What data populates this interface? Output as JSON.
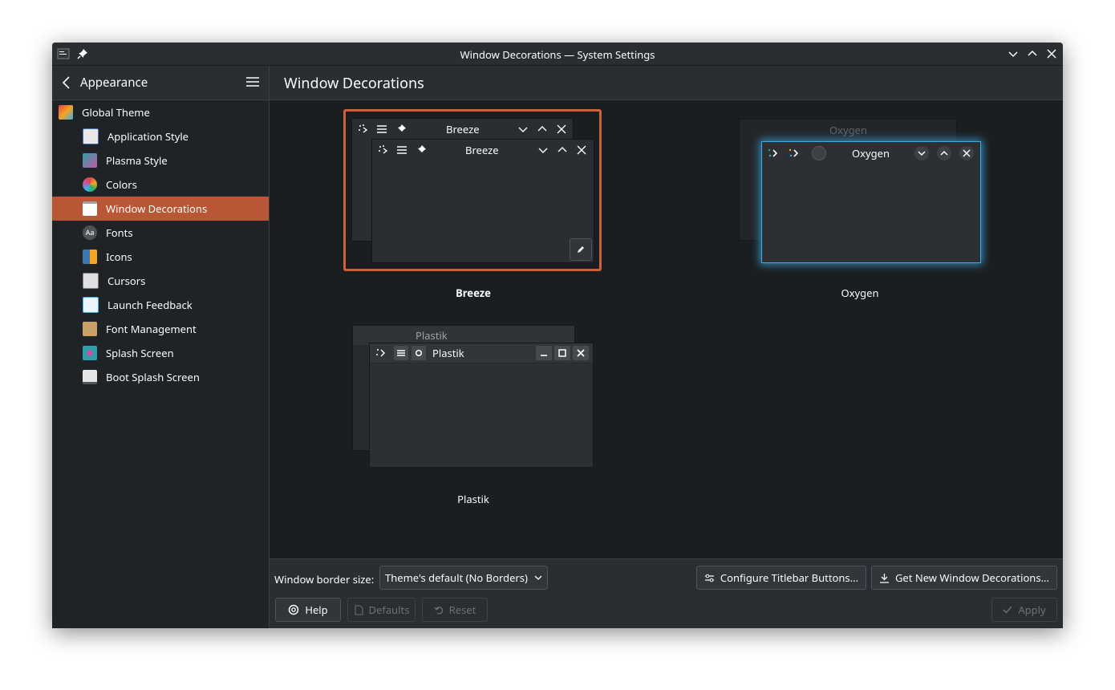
{
  "window": {
    "title": "Window Decorations — System Settings"
  },
  "sidebar": {
    "header": "Appearance",
    "items": [
      {
        "label": "Global Theme",
        "icon": "global-theme-icon",
        "color": "#e3434d"
      },
      {
        "label": "Application Style",
        "icon": "application-style-icon",
        "color": "#3d79b0"
      },
      {
        "label": "Plasma Style",
        "icon": "plasma-style-icon",
        "color": "#2e9ea8"
      },
      {
        "label": "Colors",
        "icon": "colors-icon",
        "color": "#c05aa4"
      },
      {
        "label": "Window Decorations",
        "icon": "window-decorations-icon",
        "color": "#ffffff"
      },
      {
        "label": "Fonts",
        "icon": "fonts-icon",
        "color": "#4d5358"
      },
      {
        "label": "Icons",
        "icon": "icons-icon",
        "color": "#3d79b0"
      },
      {
        "label": "Cursors",
        "icon": "cursors-icon",
        "color": "#9fa3a7"
      },
      {
        "label": "Launch Feedback",
        "icon": "launch-feedback-icon",
        "color": "#3daee9"
      },
      {
        "label": "Font Management",
        "icon": "font-management-icon",
        "color": "#c9a065"
      },
      {
        "label": "Splash Screen",
        "icon": "splash-screen-icon",
        "color": "#2e9ea8"
      },
      {
        "label": "Boot Splash Screen",
        "icon": "boot-splash-screen-icon",
        "color": "#e6e6e6"
      }
    ],
    "selected_index": 4
  },
  "content": {
    "title": "Window Decorations",
    "themes": [
      {
        "name": "Breeze",
        "selected": true,
        "preview_title": "Breeze"
      },
      {
        "name": "Oxygen",
        "selected": false,
        "preview_title": "Oxygen"
      },
      {
        "name": "Plastik",
        "selected": false,
        "preview_title": "Plastik"
      }
    ]
  },
  "footer": {
    "border_size_label": "Window border size:",
    "border_size_value": "Theme's default (No Borders)",
    "configure_button": "Configure Titlebar Buttons...",
    "get_new_button": "Get New Window Decorations...",
    "help": "Help",
    "defaults": "Defaults",
    "reset": "Reset",
    "apply": "Apply"
  },
  "colors": {
    "accent": "#b95636",
    "selection_border": "#d0603a",
    "oxygen_glow": "#3daee9"
  }
}
